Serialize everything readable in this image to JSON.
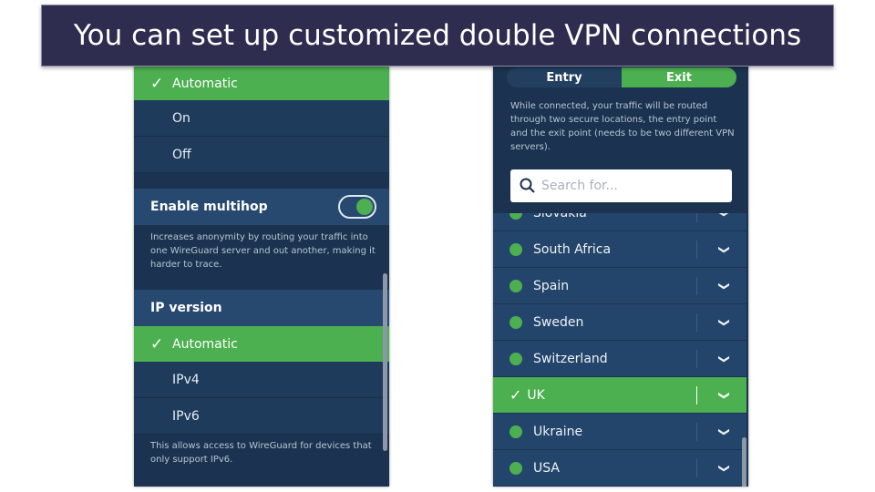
{
  "banner": {
    "title": "You can set up customized double VPN connections"
  },
  "left": {
    "options1": [
      {
        "label": "Automatic",
        "selected": true
      },
      {
        "label": "On",
        "selected": false
      },
      {
        "label": "Off",
        "selected": false
      }
    ],
    "multihop": {
      "label": "Enable multihop",
      "enabled": true,
      "description": "Increases anonymity by routing your traffic into one WireGuard server and out another, making it harder to trace."
    },
    "ip_version": {
      "label": "IP version",
      "options": [
        {
          "label": "Automatic",
          "selected": true
        },
        {
          "label": "IPv4",
          "selected": false
        },
        {
          "label": "IPv6",
          "selected": false
        }
      ],
      "description": "This allows access to WireGuard for devices that only support IPv6."
    }
  },
  "right": {
    "tabs": [
      {
        "label": "Entry",
        "active": false
      },
      {
        "label": "Exit",
        "active": true
      }
    ],
    "description": "While connected, your traffic will be routed through two secure locations, the entry point and the exit point (needs to be two different VPN servers).",
    "search": {
      "placeholder": "Search for...",
      "value": ""
    },
    "countries": [
      {
        "name": "Slovakia",
        "selected": false
      },
      {
        "name": "South Africa",
        "selected": false
      },
      {
        "name": "Spain",
        "selected": false
      },
      {
        "name": "Sweden",
        "selected": false
      },
      {
        "name": "Switzerland",
        "selected": false
      },
      {
        "name": "UK",
        "selected": true
      },
      {
        "name": "Ukraine",
        "selected": false
      },
      {
        "name": "USA",
        "selected": false
      }
    ]
  },
  "colors": {
    "accent": "#4caf50",
    "panel": "#1b3350",
    "banner": "#2e2c4f"
  }
}
